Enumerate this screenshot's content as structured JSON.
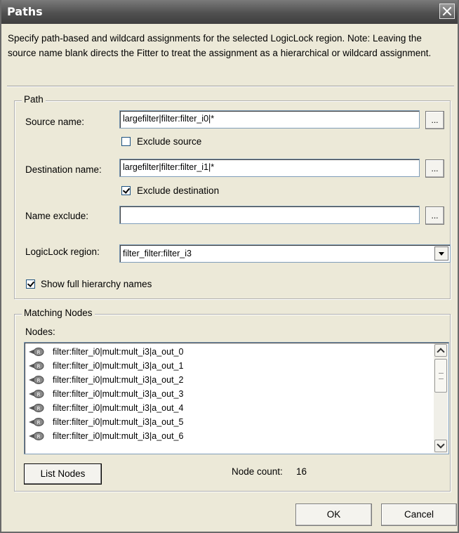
{
  "window": {
    "title": "Paths"
  },
  "description": "Specify path-based and wildcard assignments for the selected LogicLock region. Note: Leaving the source name blank directs the Fitter to treat the assignment as a hierarchical or wildcard assignment.",
  "path_group": {
    "legend": "Path",
    "source_label": "Source name:",
    "source_value": "largefilter|filter:filter_i0|*",
    "exclude_source_label": "Exclude source",
    "exclude_source_checked": false,
    "destination_label": "Destination name:",
    "destination_value": "largefilter|filter:filter_i1|*",
    "exclude_destination_label": "Exclude destination",
    "exclude_destination_checked": true,
    "name_exclude_label": "Name exclude:",
    "name_exclude_value": "",
    "browse_label": "...",
    "logiclock_label": "LogicLock region:",
    "logiclock_value": "filter_filter:filter_i3",
    "show_hierarchy_label": "Show full hierarchy names",
    "show_hierarchy_checked": true
  },
  "matching_group": {
    "legend": "Matching Nodes",
    "nodes_label": "Nodes:",
    "nodes": [
      "filter:filter_i0|mult:mult_i3|a_out_0",
      "filter:filter_i0|mult:mult_i3|a_out_1",
      "filter:filter_i0|mult:mult_i3|a_out_2",
      "filter:filter_i0|mult:mult_i3|a_out_3",
      "filter:filter_i0|mult:mult_i3|a_out_4",
      "filter:filter_i0|mult:mult_i3|a_out_5",
      "filter:filter_i0|mult:mult_i3|a_out_6"
    ],
    "node_icon": "register-node-icon",
    "list_nodes_label": "List Nodes",
    "node_count_label": "Node count:",
    "node_count_value": "16"
  },
  "footer": {
    "ok_label": "OK",
    "cancel_label": "Cancel"
  }
}
